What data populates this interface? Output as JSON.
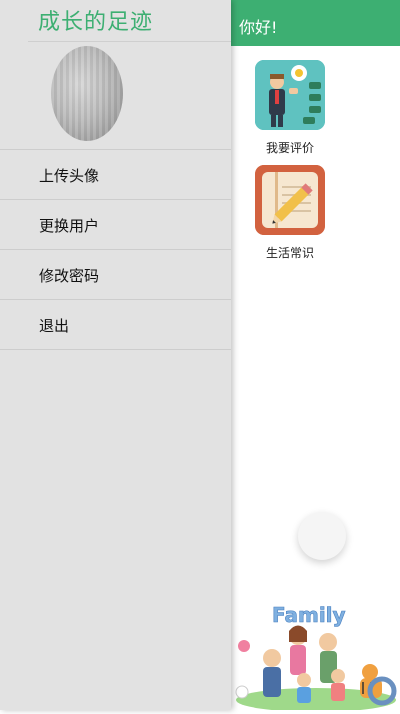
{
  "topbar": {
    "title": "你好!"
  },
  "tiles": [
    {
      "label": "我要评价",
      "icon": "evaluate-icon"
    },
    {
      "label": "生活常识",
      "icon": "notebook-pencil-icon"
    }
  ],
  "family_art": {
    "text": "Family"
  },
  "drawer": {
    "title": "成长的足迹",
    "menu": [
      {
        "label": "上传头像"
      },
      {
        "label": "更换用户"
      },
      {
        "label": "修改密码"
      },
      {
        "label": "退出"
      }
    ]
  },
  "colors": {
    "accent": "#3daf72",
    "drawer_bg": "#e2e2e2"
  }
}
